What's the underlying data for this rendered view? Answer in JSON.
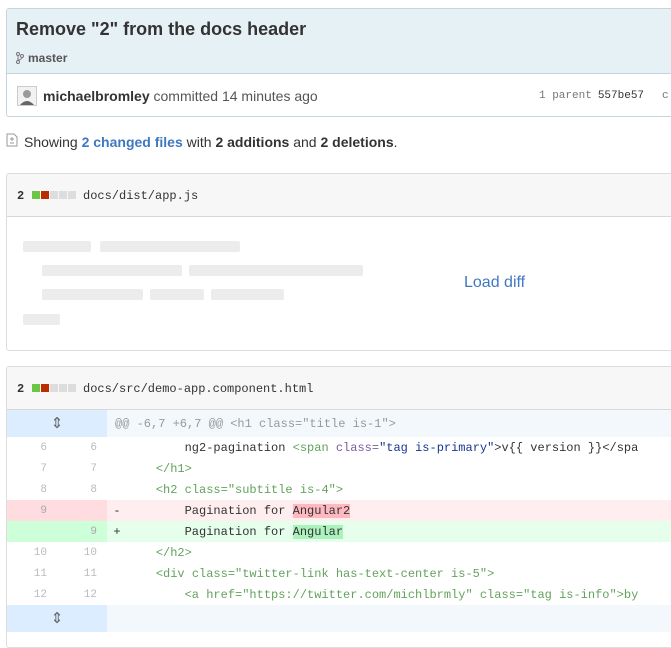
{
  "commit": {
    "title": "Remove \"2\" from the docs header",
    "branch": "master",
    "author": "michaelbromley",
    "action": "committed",
    "time": "14 minutes ago",
    "parent_label": "1 parent",
    "parent_sha": "557be57",
    "cut_text": "c"
  },
  "toc": {
    "showing": "Showing",
    "changed_files": "2 changed files",
    "with": "with",
    "additions": "2 additions",
    "and": "and",
    "deletions": "2 deletions",
    "end": "."
  },
  "files": [
    {
      "count": "2",
      "name": "docs/dist/app.js",
      "diffstat": [
        "#6cc644",
        "#bd2c00",
        "#ddd",
        "#ddd",
        "#ddd"
      ],
      "load_label": "Load diff"
    },
    {
      "count": "2",
      "name": "docs/src/demo-app.component.html",
      "diffstat": [
        "#6cc644",
        "#bd2c00",
        "#ddd",
        "#ddd",
        "#ddd"
      ],
      "hunk": "@@ -6,7 +6,7 @@ <h1 class=\"title is-1\">",
      "lines": [
        {
          "old": "6",
          "new": "6",
          "sign": "",
          "indent": "        ",
          "pre": "ng2-pagination ",
          "tag_open": "<span ",
          "attr": "class=",
          "str": "\"tag is-primary\"",
          "post": ">v{{ version }}</spa"
        },
        {
          "old": "7",
          "new": "7",
          "sign": "",
          "indent": "    ",
          "text": "</h1>"
        },
        {
          "old": "8",
          "new": "8",
          "sign": "",
          "indent": "    ",
          "text": "<h2 class=\"subtitle is-4\">"
        },
        {
          "old": "9",
          "new": "",
          "sign": "-",
          "indent": "        ",
          "pre": "Pagination for ",
          "hl": "Angular2"
        },
        {
          "old": "",
          "new": "9",
          "sign": "+",
          "indent": "        ",
          "pre": "Pagination for ",
          "hl": "Angular"
        },
        {
          "old": "10",
          "new": "10",
          "sign": "",
          "indent": "    ",
          "text": "</h2>"
        },
        {
          "old": "11",
          "new": "11",
          "sign": "",
          "indent": "    ",
          "text": "<div class=\"twitter-link has-text-center is-5\">"
        },
        {
          "old": "12",
          "new": "12",
          "sign": "",
          "indent": "        ",
          "text": "<a href=\"https://twitter.com/michlbrmly\" class=\"tag is-info\">by"
        }
      ]
    }
  ],
  "icons": {
    "branch": "git-branch-icon",
    "toc": "file-diff-icon",
    "expand": "unfold-icon"
  }
}
